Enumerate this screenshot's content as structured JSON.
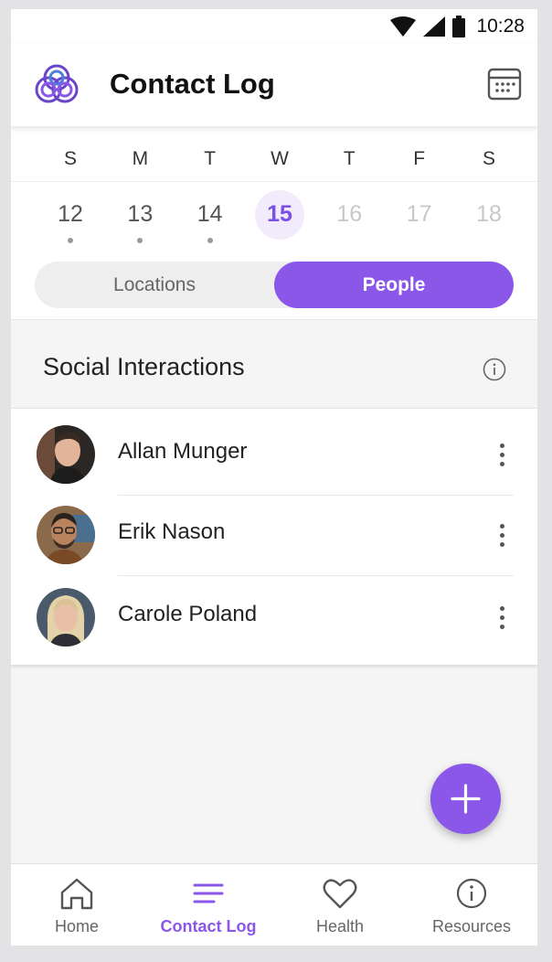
{
  "status_bar": {
    "time": "10:28"
  },
  "app_bar": {
    "title": "Contact Log"
  },
  "week": {
    "day_letters": [
      "S",
      "M",
      "T",
      "W",
      "T",
      "F",
      "S"
    ],
    "days": [
      {
        "num": "12",
        "state": "past",
        "has_dot": true
      },
      {
        "num": "13",
        "state": "past",
        "has_dot": true
      },
      {
        "num": "14",
        "state": "past",
        "has_dot": true
      },
      {
        "num": "15",
        "state": "selected",
        "has_dot": false
      },
      {
        "num": "16",
        "state": "future",
        "has_dot": false
      },
      {
        "num": "17",
        "state": "future",
        "has_dot": false
      },
      {
        "num": "18",
        "state": "future",
        "has_dot": false
      }
    ]
  },
  "segmented": {
    "locations_label": "Locations",
    "people_label": "People",
    "active": "People"
  },
  "section": {
    "title": "Social Interactions"
  },
  "people": [
    {
      "name": "Allan Munger"
    },
    {
      "name": "Erik Nason"
    },
    {
      "name": "Carole Poland"
    }
  ],
  "bottom_nav": {
    "items": [
      {
        "label": "Home",
        "icon": "home-icon"
      },
      {
        "label": "Contact Log",
        "icon": "list-icon",
        "active": true
      },
      {
        "label": "Health",
        "icon": "heart-icon"
      },
      {
        "label": "Resources",
        "icon": "info-icon"
      }
    ]
  },
  "colors": {
    "accent": "#8b57e9",
    "accent_light": "#f1ebfb",
    "background": "#f5f5f5"
  }
}
